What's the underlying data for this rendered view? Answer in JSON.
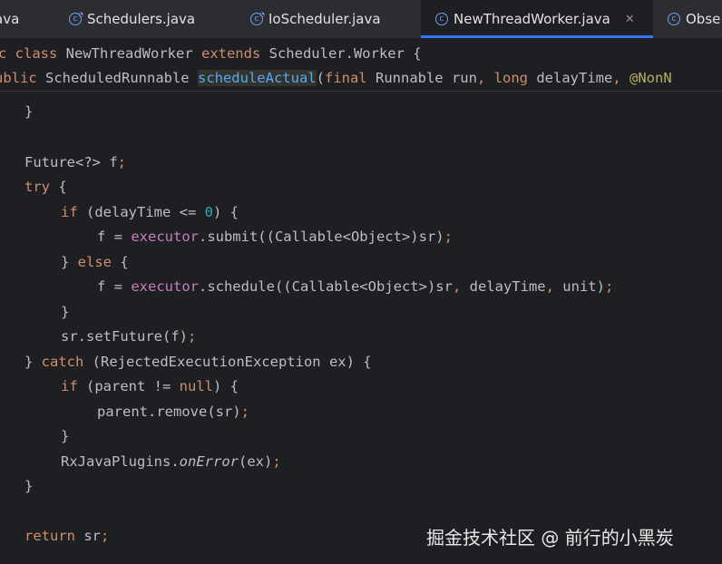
{
  "tabs": [
    {
      "label": "ava",
      "icon": "none"
    },
    {
      "label": "Schedulers.java",
      "icon": "class-icon"
    },
    {
      "label": "IoScheduler.java",
      "icon": "class-icon"
    },
    {
      "label": "NewThreadWorker.java",
      "icon": "class-icon",
      "active": true,
      "close": "✕"
    },
    {
      "label": "Obse",
      "icon": "class-icon"
    }
  ],
  "sticky": {
    "line1": {
      "t1": "c ",
      "t2": "class",
      "t3": " NewThreadWorker ",
      "t4": "extends",
      "t5": " Scheduler.Worker {"
    },
    "line2": {
      "t1": "ublic",
      "t2": " ScheduledRunnable ",
      "t3": "scheduleActual",
      "t4": "(",
      "t5": "final",
      "t6": " Runnable run",
      "t7": ",",
      "t8": " long",
      "t9": " delayTime",
      "t10": ",",
      "t11": " @NonN"
    }
  },
  "code": {
    "l1": "}",
    "l2": {
      "a": "Future<?> f",
      "b": ";"
    },
    "l3": {
      "a": "try",
      "b": " {"
    },
    "l4": {
      "a": "if",
      "b": " (delayTime <= ",
      "c": "0",
      "d": ") {"
    },
    "l5": {
      "a": "f = ",
      "b": "executor",
      "c": ".submit((Callable<Object>)sr)",
      "d": ";"
    },
    "l6": {
      "a": "} ",
      "b": "else",
      "c": " {"
    },
    "l7": {
      "a": "f = ",
      "b": "executor",
      "c": ".schedule((Callable<Object>)sr",
      "d": ",",
      "e": " delayTime",
      "f": ",",
      "g": " unit)",
      "h": ";"
    },
    "l8": "}",
    "l9": {
      "a": "sr.setFuture(f)",
      "b": ";"
    },
    "l10": {
      "a": "} ",
      "b": "catch",
      "c": " (RejectedExecutionException ex) {"
    },
    "l11": {
      "a": "if",
      "b": " (parent != ",
      "c": "null",
      "d": ") {"
    },
    "l12": {
      "a": "parent.remove(sr)",
      "b": ";"
    },
    "l13": "}",
    "l14": {
      "a": "RxJavaPlugins.",
      "b": "onError",
      "c": "(ex)",
      "d": ";"
    },
    "l15": "}",
    "l16": {
      "a": "return",
      "b": " sr",
      "c": ";"
    }
  },
  "watermark": "掘金技术社区 @ 前行的小黑炭",
  "colors": {
    "keyword": "#cf8e6d",
    "field": "#c77dbb",
    "number": "#2aacb8",
    "method": "#56a8f5",
    "annotation": "#b3ae60",
    "text": "#bcbec4",
    "accent": "#3574f0"
  }
}
